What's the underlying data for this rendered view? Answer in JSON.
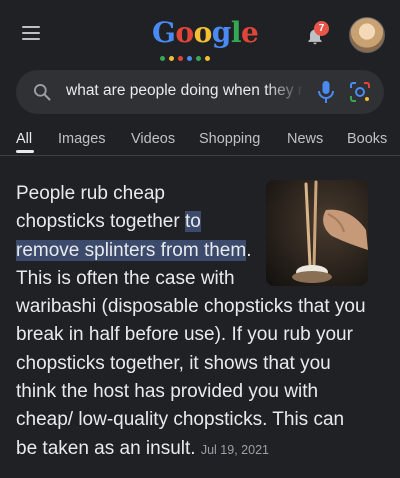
{
  "header": {
    "logo_letters": [
      "G",
      "o",
      "o",
      "g",
      "l",
      "e"
    ],
    "notification_count": "7",
    "logo_colors": [
      "#4a8af4",
      "#e0453a",
      "#f5be33",
      "#4a8af4",
      "#35a853",
      "#e0453a"
    ]
  },
  "search": {
    "query": "what are people doing when they rub chopsticks together"
  },
  "tabs": [
    {
      "label": "All"
    },
    {
      "label": "Images"
    },
    {
      "label": "Videos"
    },
    {
      "label": "Shopping"
    },
    {
      "label": "News"
    },
    {
      "label": "Books"
    }
  ],
  "snippet": {
    "text_before": "People rub cheap chopsticks together ",
    "highlight": "to remove splinters from them",
    "text_after": ". This is often the case with waribashi (disposable chopsticks that you break in half before use). If you rub your chopsticks together, it shows that you think the host has provided you with cheap/ low-quality chopsticks. This can be taken as an insult.",
    "date": "Jul 19, 2021",
    "highlight_color": "#3c4a6b"
  }
}
